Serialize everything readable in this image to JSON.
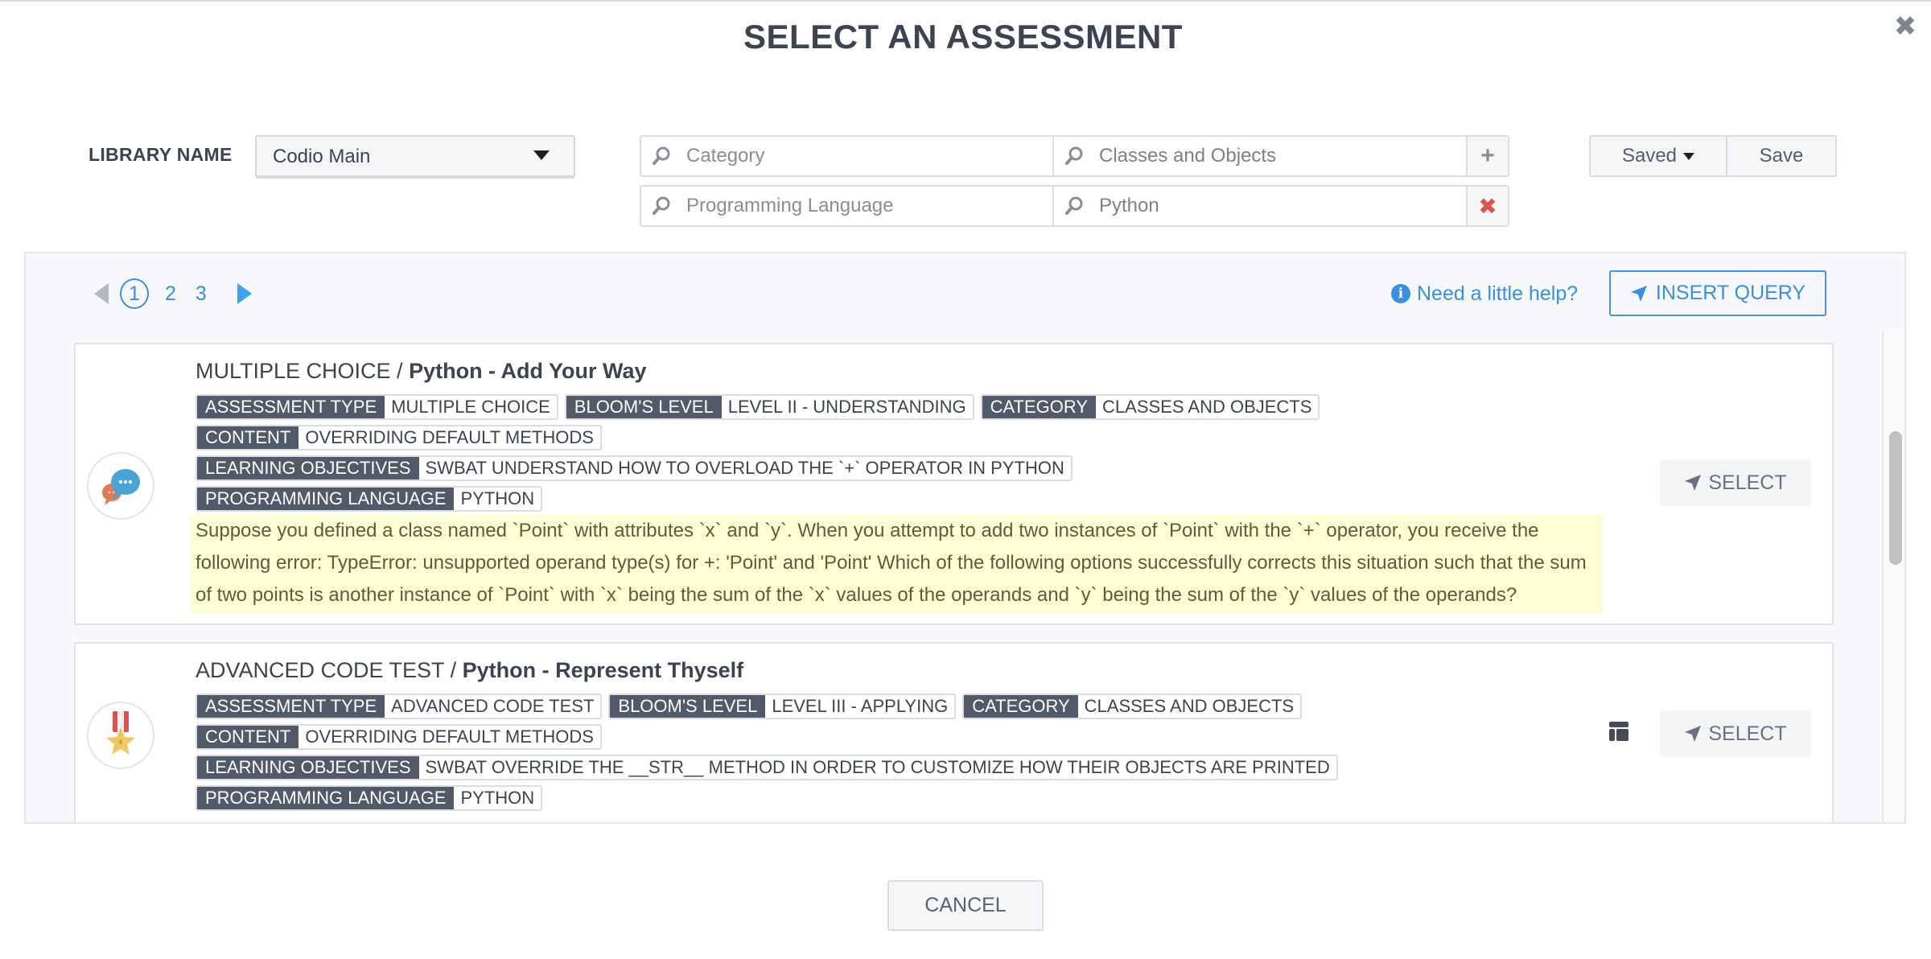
{
  "modal": {
    "title": "SELECT AN ASSESSMENT",
    "close_icon": "close-icon"
  },
  "library": {
    "label": "LIBRARY NAME",
    "selected": "Codio Main"
  },
  "filters": [
    {
      "key_placeholder": "Category",
      "value": "Classes and Objects",
      "action": "add",
      "action_glyph": "+"
    },
    {
      "key_placeholder": "Programming Language",
      "value": "Python",
      "action": "remove",
      "action_glyph": "✖"
    }
  ],
  "saved_controls": {
    "saved_label": "Saved",
    "save_label": "Save"
  },
  "pagination": {
    "current": 1,
    "pages": [
      "1",
      "2",
      "3"
    ]
  },
  "help_link": "Need a little help?",
  "insert_query_label": "INSERT QUERY",
  "assessments": [
    {
      "type": "MULTIPLE CHOICE",
      "name": "Python - Add Your Way",
      "icon": "chat-bubbles-icon",
      "tags": [
        {
          "key": "ASSESSMENT TYPE",
          "value": "MULTIPLE CHOICE"
        },
        {
          "key": "BLOOM'S LEVEL",
          "value": "LEVEL II - UNDERSTANDING"
        },
        {
          "key": "CATEGORY",
          "value": "CLASSES AND OBJECTS"
        },
        {
          "key": "CONTENT",
          "value": "OVERRIDING DEFAULT METHODS"
        },
        {
          "key": "LEARNING OBJECTIVES",
          "value": "SWBAT UNDERSTAND HOW TO OVERLOAD THE `+` OPERATOR IN PYTHON"
        },
        {
          "key": "PROGRAMMING LANGUAGE",
          "value": "PYTHON"
        }
      ],
      "question": "Suppose you defined a class named `Point` with attributes `x` and `y`. When you attempt to add two instances of `Point` with the `+` operator, you receive the following error: TypeError: unsupported operand type(s) for +: 'Point' and 'Point' Which of the following options successfully corrects this situation such that the sum of two points is another instance of `Point` with `x` being the sum of the `x` values of the operands and `y` being the sum of the `y` values of the operands?",
      "select_label": "SELECT"
    },
    {
      "type": "ADVANCED CODE TEST",
      "name": "Python - Represent Thyself",
      "icon": "medal-icon",
      "tags": [
        {
          "key": "ASSESSMENT TYPE",
          "value": "ADVANCED CODE TEST"
        },
        {
          "key": "BLOOM'S LEVEL",
          "value": "LEVEL III - APPLYING"
        },
        {
          "key": "CATEGORY",
          "value": "CLASSES AND OBJECTS"
        },
        {
          "key": "CONTENT",
          "value": "OVERRIDING DEFAULT METHODS"
        },
        {
          "key": "LEARNING OBJECTIVES",
          "value": "SWBAT OVERRIDE THE __STR__ METHOD IN ORDER TO CUSTOMIZE HOW THEIR OBJECTS ARE PRINTED"
        },
        {
          "key": "PROGRAMMING LANGUAGE",
          "value": "PYTHON"
        }
      ],
      "select_label": "SELECT"
    }
  ],
  "cancel_label": "CANCEL",
  "colors": {
    "accent": "#3a8fe0",
    "tag_key_bg": "#525a6a",
    "question_highlight": "#fdfdd6",
    "remove": "#d9534f"
  }
}
